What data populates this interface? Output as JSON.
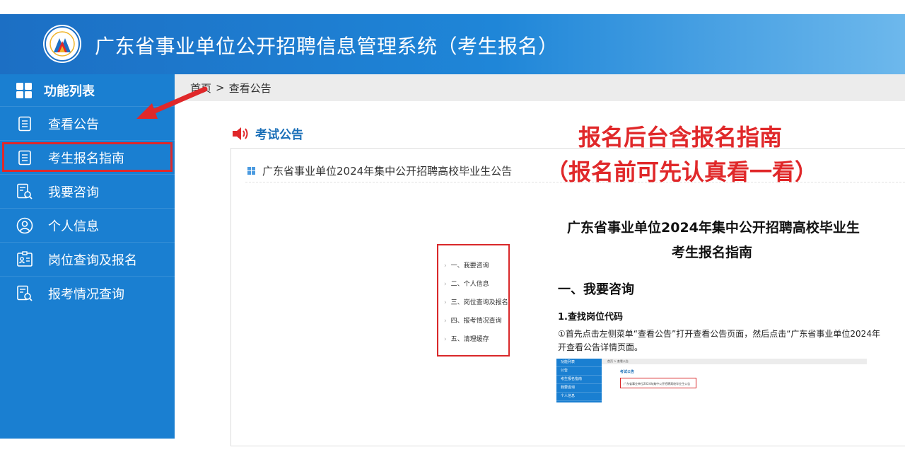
{
  "header": {
    "title": "广东省事业单位公开招聘信息管理系统（考生报名）"
  },
  "sidebar": {
    "heading": "功能列表",
    "items": [
      {
        "label": "查看公告",
        "icon": "document-list-icon"
      },
      {
        "label": "考生报名指南",
        "icon": "document-list-icon"
      },
      {
        "label": "我要咨询",
        "icon": "search-document-icon"
      },
      {
        "label": "个人信息",
        "icon": "user-circle-icon"
      },
      {
        "label": "岗位查询及报名",
        "icon": "id-card-icon"
      },
      {
        "label": "报考情况查询",
        "icon": "search-document-icon"
      }
    ]
  },
  "breadcrumb": {
    "home": "首页",
    "separator": ">",
    "current": "查看公告"
  },
  "notice": {
    "heading": "考试公告",
    "items": [
      "广东省事业单位2024年集中公开招聘高校毕业生公告"
    ]
  },
  "annotation": {
    "line1": "报名后台含报名指南",
    "line2": "（报名前可先认真看一看）"
  },
  "guide": {
    "title_line1": "广东省事业单位2024年集中公开招聘高校毕业生",
    "title_line2": "考生报名指南",
    "toc": [
      "一、我要咨询",
      "二、个人信息",
      "三、岗位查询及报名",
      "四、报考情况查询",
      "五、清理缓存"
    ],
    "section1": "一、我要咨询",
    "sub1": "1.查找岗位代码",
    "para_line1": "①首先点击左侧菜单“查看公告”打开查看公告页面，然后点击“广东省事业单位2024年",
    "para_line2": "开查看公告详情页面。"
  },
  "thumbnail": {
    "side_items": [
      "功能列表",
      "公告",
      "考生报名指南",
      "我要咨询",
      "个人信息"
    ],
    "breadcrumb": "首页 > 查看公告",
    "notice_heading": "考试公告",
    "notice_item": "广东省事业单位2024年集中公开招聘高校毕业生公告"
  },
  "colors": {
    "header_blue": "#1c6fc4",
    "sidebar_blue": "#1a7fd1",
    "annotation_red": "#e0282a"
  }
}
